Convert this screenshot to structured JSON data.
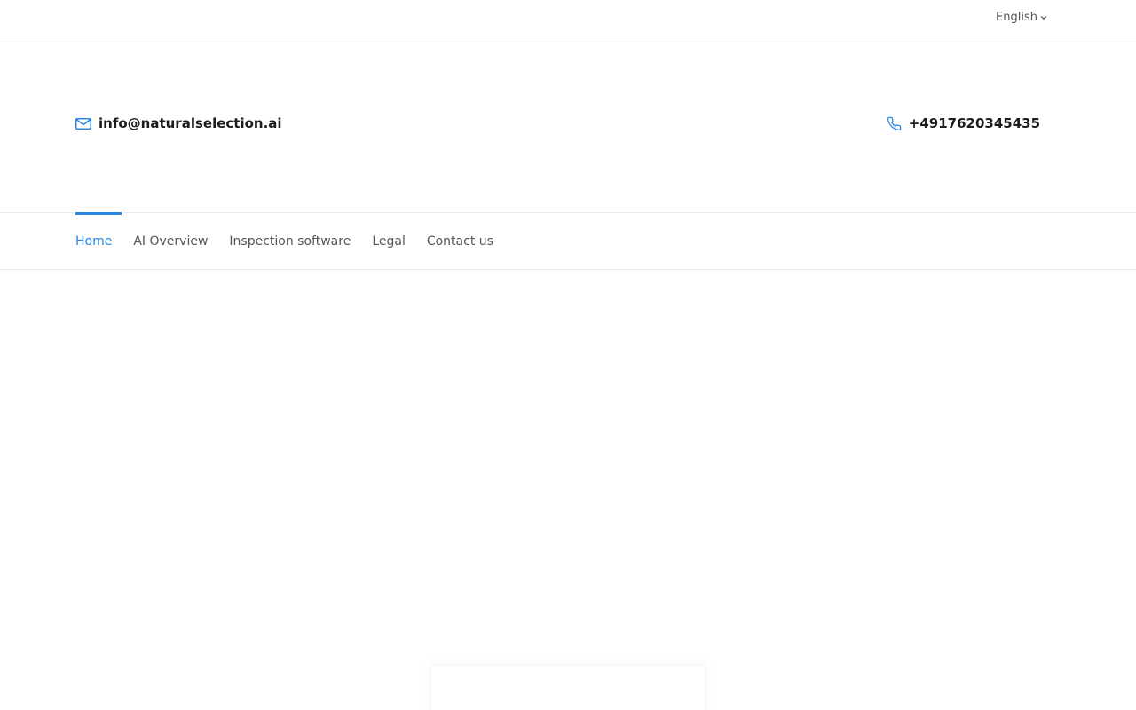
{
  "topbar": {
    "language": "English",
    "language_icon": "chevron-down-icon"
  },
  "contact": {
    "email": "info@naturalselection.ai",
    "email_icon": "mail-icon",
    "phone": "+4917620345435",
    "phone_icon": "phone-icon"
  },
  "nav": {
    "items": [
      {
        "label": "Home",
        "active": true
      },
      {
        "label": "AI Overview",
        "active": false
      },
      {
        "label": "Inspection software",
        "active": false
      },
      {
        "label": "Legal",
        "active": false
      },
      {
        "label": "Contact us",
        "active": false
      }
    ]
  },
  "colors": {
    "accent": "#2a86e0",
    "text": "#1c1c1c",
    "muted": "#555555",
    "border": "#ececec"
  }
}
